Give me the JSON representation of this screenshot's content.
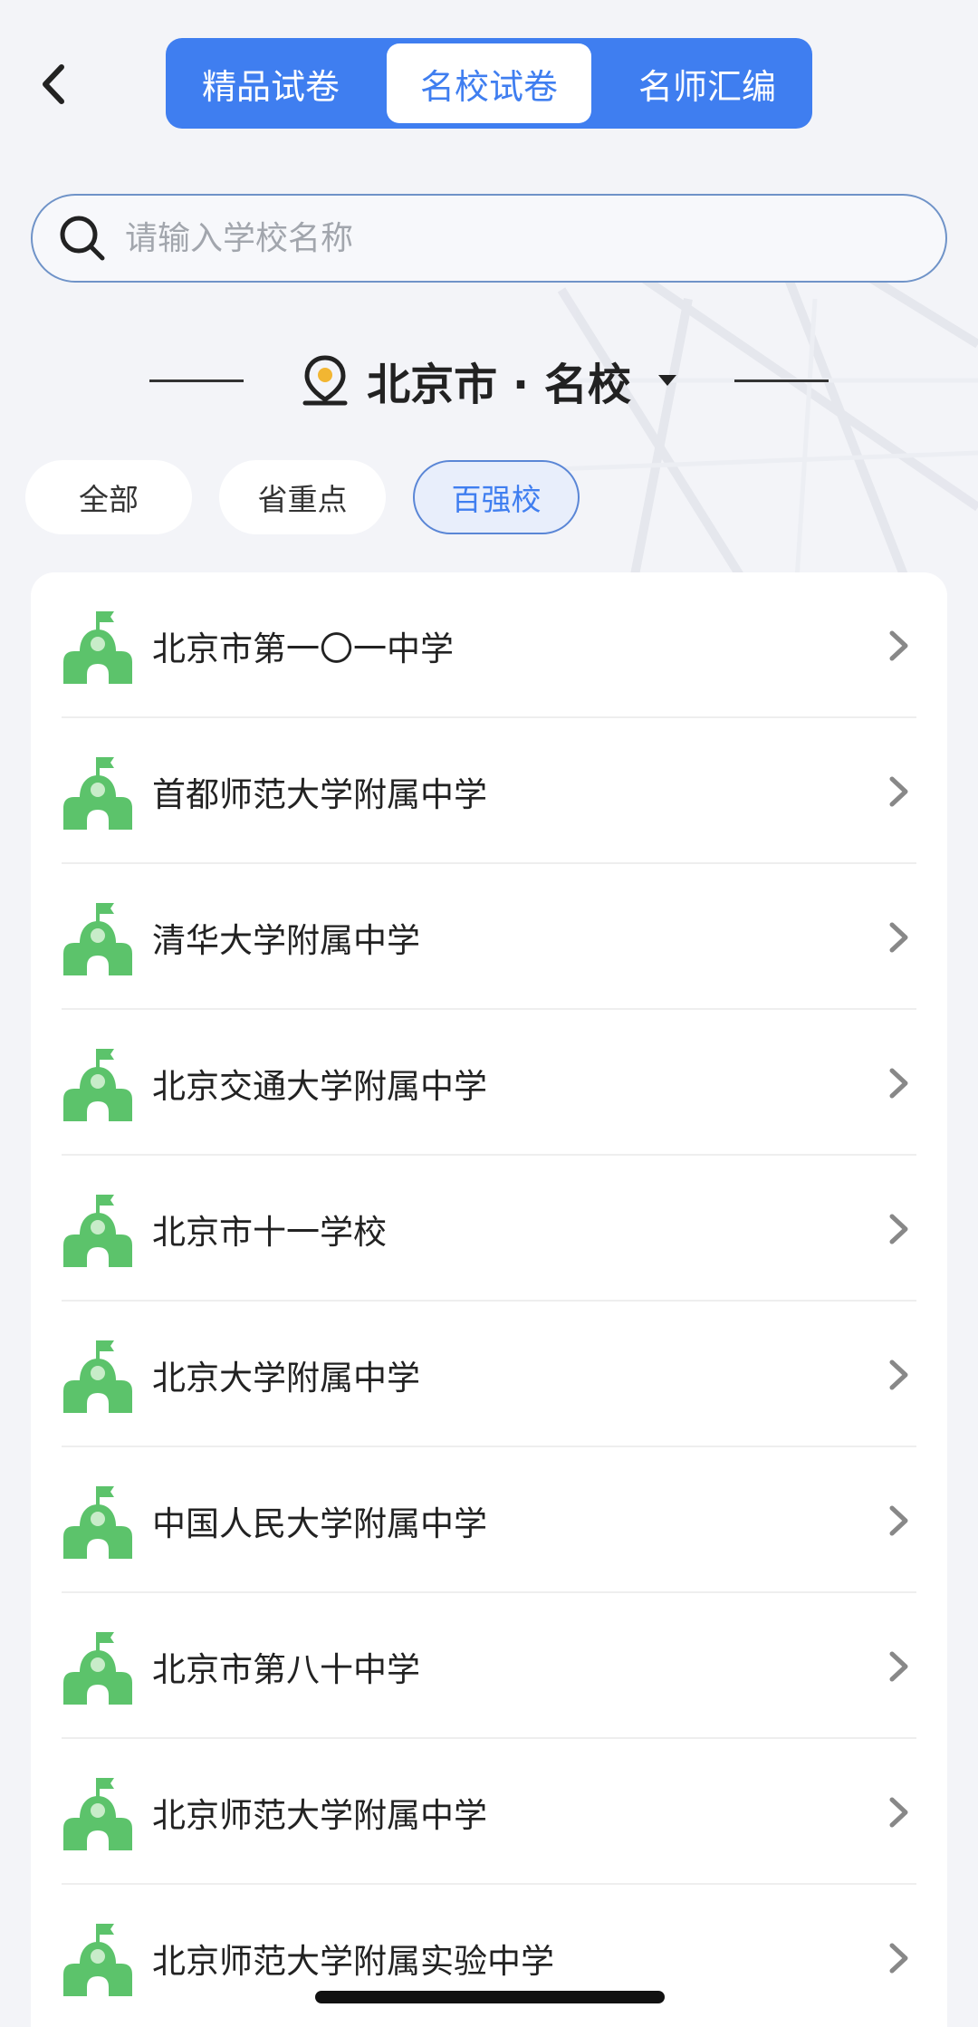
{
  "header": {
    "tabs": [
      {
        "label": "精品试卷"
      },
      {
        "label": "名校试卷"
      },
      {
        "label": "名师汇编"
      }
    ]
  },
  "search": {
    "placeholder": "请输入学校名称"
  },
  "region": {
    "title": "北京市 · 名校"
  },
  "filters": [
    {
      "label": "全部"
    },
    {
      "label": "省重点"
    },
    {
      "label": "百强校"
    }
  ],
  "schools": [
    {
      "name": "北京市第一〇一中学"
    },
    {
      "name": "首都师范大学附属中学"
    },
    {
      "name": "清华大学附属中学"
    },
    {
      "name": "北京交通大学附属中学"
    },
    {
      "name": "北京市十一学校"
    },
    {
      "name": "北京大学附属中学"
    },
    {
      "name": "中国人民大学附属中学"
    },
    {
      "name": "北京市第八十中学"
    },
    {
      "name": "北京师范大学附属中学"
    },
    {
      "name": "北京师范大学附属实验中学"
    }
  ],
  "colors": {
    "accent": "#3f7ef0",
    "school_icon": "#5cc36b",
    "location_pin": "#f2b632"
  }
}
